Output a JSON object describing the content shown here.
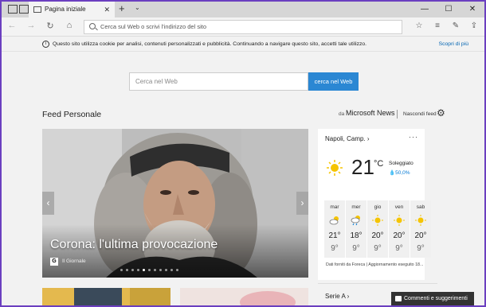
{
  "tab": {
    "label": "Pagina iniziale"
  },
  "address": {
    "placeholder": "Cerca sul Web o scrivi l'indirizzo del sito"
  },
  "cookie": {
    "text": "Questo sito utilizza cookie per analisi, contenuti personalizzati e pubblicità. Continuando a navigare questo sito, accetti tale utilizzo.",
    "link": "Scopri di più"
  },
  "search": {
    "placeholder": "Cerca nel Web",
    "button": "cerca nel Web"
  },
  "feed": {
    "title": "Feed Personale",
    "by": "da",
    "provider": "Microsoft News",
    "hide": "Nascondi feed"
  },
  "hero": {
    "headline": "Corona: l'ultima provocazione",
    "source_icon": "G",
    "source": "Il Giornale",
    "slide_count": 11,
    "active_slide": 4
  },
  "weather": {
    "city": "Napoli, Camp.",
    "temp": "21",
    "unit": "°C",
    "condition": "Soleggiato",
    "humidity": "50,0%",
    "days": [
      {
        "name": "mar",
        "hi": "21°",
        "lo": "9°",
        "icon": "partly-cloudy-icon"
      },
      {
        "name": "mer",
        "hi": "18°",
        "lo": "9°",
        "icon": "rain-cloud-icon"
      },
      {
        "name": "gio",
        "hi": "20°",
        "lo": "9°",
        "icon": "sun-icon"
      },
      {
        "name": "ven",
        "hi": "20°",
        "lo": "9°",
        "icon": "sun-icon"
      },
      {
        "name": "sab",
        "hi": "20°",
        "lo": "9°",
        "icon": "sun-icon"
      }
    ],
    "footer": "Dati forniti da Foreca | Aggiornamento eseguito 18..."
  },
  "serie": {
    "label": "Serie A"
  },
  "comments": {
    "label": "Commenti e suggerimenti"
  },
  "colors": {
    "accent": "#2b87d3",
    "window_border": "#6b3fc0",
    "sun": "#f5c400"
  }
}
